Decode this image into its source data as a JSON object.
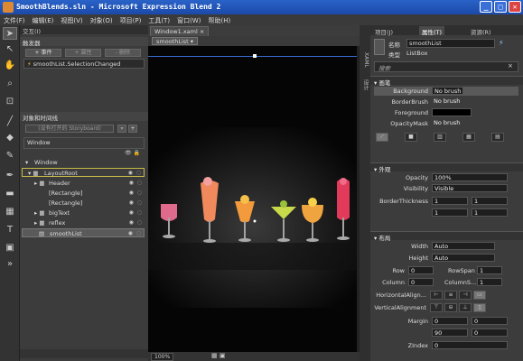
{
  "window": {
    "title": "SmoothBlends.sln - Microsoft Expression Blend 2",
    "min": "_",
    "max": "□",
    "close": "✕"
  },
  "menu": [
    "文件(F)",
    "编辑(E)",
    "视图(V)",
    "对象(O)",
    "项目(P)",
    "工具(T)",
    "窗口(W)",
    "帮助(H)"
  ],
  "left": {
    "interaction_header": "交互(I)",
    "triggers_header": "触发器",
    "event_btn": "+ 事件",
    "property_btn": "+ 属性",
    "delete_btn": "- 删除",
    "trigger_item": "smoothList.SelectionChanged",
    "objects_header": "对象和时间线",
    "storyboard": "(没有打开的 Storyboard)",
    "scope": "Window",
    "tree": [
      {
        "label": "Window",
        "depth": 0
      },
      {
        "label": "LayoutRoot",
        "depth": 1
      },
      {
        "label": "Header",
        "depth": 2
      },
      {
        "label": "[Rectangle]",
        "depth": 2
      },
      {
        "label": "[Rectangle]",
        "depth": 2
      },
      {
        "label": "bigText",
        "depth": 2
      },
      {
        "label": "reflex",
        "depth": 2
      },
      {
        "label": "smoothList",
        "depth": 2
      }
    ]
  },
  "doc": {
    "tab": "Window1.xaml",
    "crumb": "smoothList ▾",
    "zoom": "100%"
  },
  "right": {
    "tabs": [
      "项目(J)",
      "属性(T)",
      "资源(R)"
    ],
    "name_label": "名称",
    "name_value": "smoothList",
    "type_label": "类型",
    "type_value": "ListBox",
    "search_placeholder": "搜索",
    "brushes_header": "画笔",
    "brushes": [
      {
        "label": "Background",
        "value": "No brush"
      },
      {
        "label": "BorderBrush",
        "value": "No brush"
      },
      {
        "label": "Foreground",
        "value": ""
      },
      {
        "label": "OpacityMask",
        "value": "No brush"
      }
    ],
    "appearance_header": "外观",
    "opacity_label": "Opacity",
    "opacity_value": "100%",
    "visibility_label": "Visibility",
    "visibility_value": "Visible",
    "border_label": "BorderThickness",
    "border_values": [
      "1",
      "1",
      "1",
      "1"
    ],
    "layout_header": "布局",
    "width_label": "Width",
    "width_value": "Auto",
    "height_label": "Height",
    "height_value": "Auto",
    "row_label": "Row",
    "row_value": "0",
    "rowspan_label": "RowSpan",
    "rowspan_value": "1",
    "column_label": "Column",
    "column_value": "0",
    "colspan_label": "ColumnS...",
    "colspan_value": "1",
    "halign_label": "HorizontalAlign...",
    "valign_label": "VerticalAlignment",
    "margin_label": "Margin",
    "margin_values": [
      "0",
      "0",
      "90",
      "0"
    ],
    "zindex_label": "ZIndex",
    "zindex_value": "0"
  },
  "side_tabs": [
    "XAML",
    "设计"
  ],
  "colors": {
    "accent": "#3a6bd2",
    "highlight": "#c9b94a"
  }
}
